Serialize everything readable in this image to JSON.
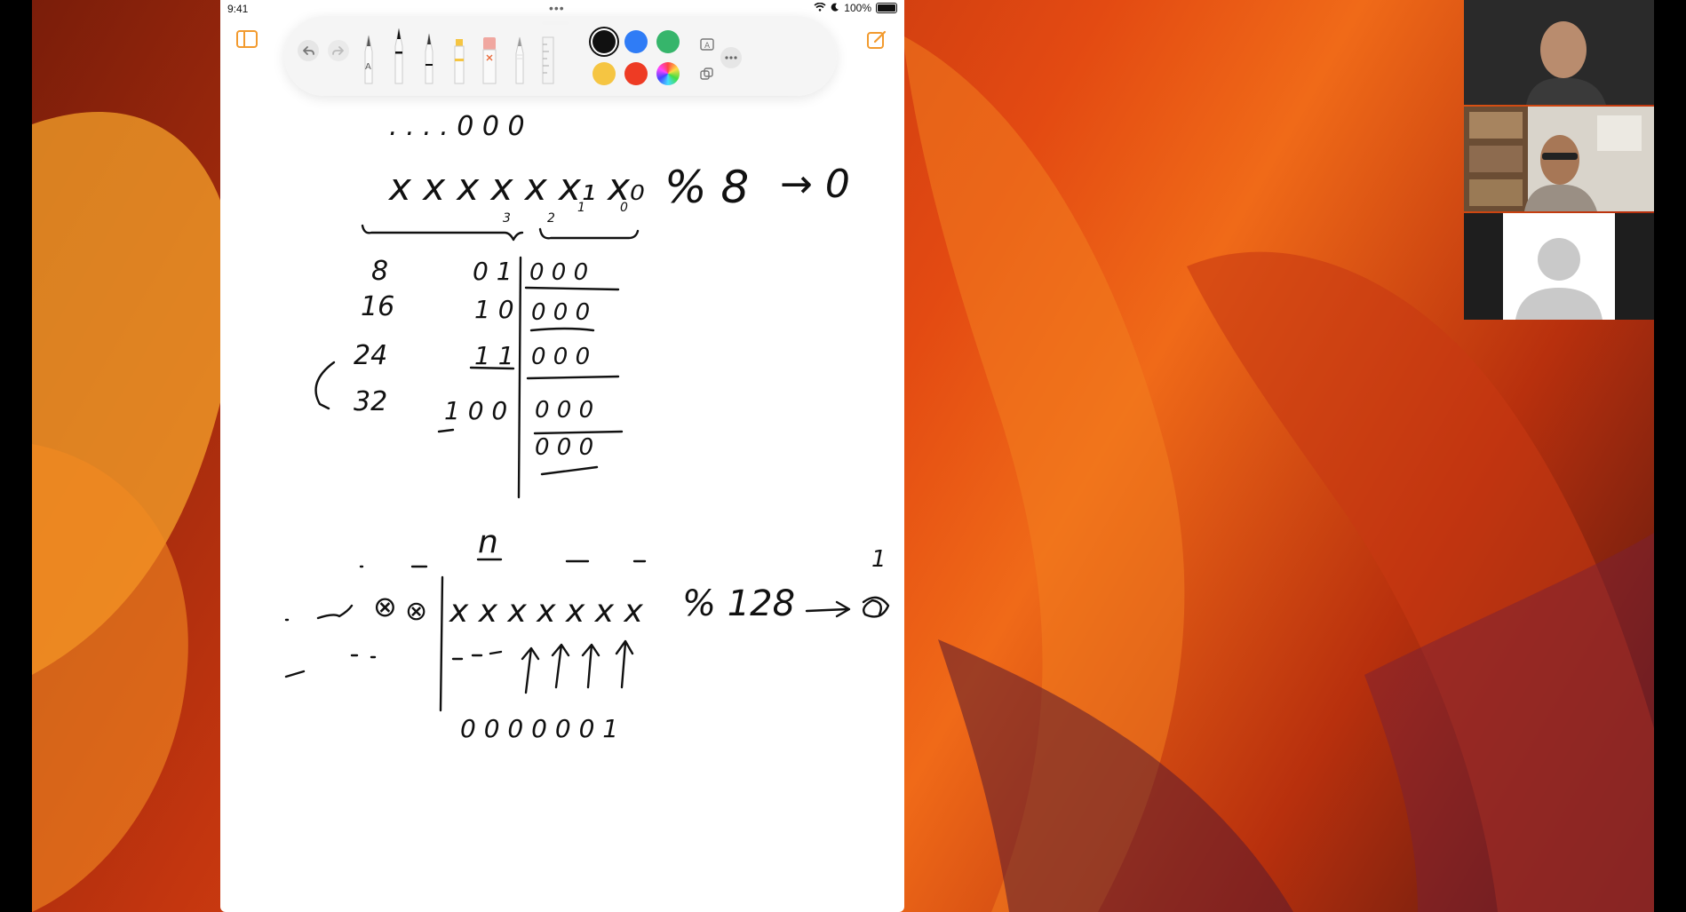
{
  "status_bar": {
    "time": "9:41",
    "battery": "100%",
    "multitask_dots": "•••"
  },
  "toolbar": {
    "undo_icon": "undo-icon",
    "redo_icon": "redo-icon",
    "tools": [
      "pen-a-tool",
      "pen-tool",
      "monoline-tool",
      "highlighter-tool",
      "eraser-tool",
      "pencil-tool",
      "ruler-tool"
    ],
    "colors": {
      "black": "#111111",
      "blue": "#2f7cf6",
      "green": "#36b56b",
      "yellow": "#f5c542",
      "red": "#ee3b24"
    },
    "more_icon": "ellipsis-icon"
  },
  "colors": {
    "accent": "#f29a2e",
    "wallpaper_main": "#e34a12"
  },
  "canvas": {
    "note_top": ". . . . 0 0 0",
    "bits_row": "x x x x x x₁ x₀",
    "mod8": "% 8",
    "arrow_result": "→ 0",
    "sub_3": "3",
    "sub_2": "2",
    "sub_1": "1",
    "sub_0": "0",
    "table_left": [
      "8",
      "16",
      "24",
      "32"
    ],
    "table_mid": [
      "0 1",
      "1 0",
      "1 1",
      "1 0 0"
    ],
    "table_right": [
      "0 0 0",
      "0 0 0",
      "0 0 0",
      "0 0 0",
      "0 0 0"
    ],
    "n_label": "n",
    "bits_row_2": "x x x x x x x",
    "mod128": "% 128",
    "one_label": "1",
    "bottom_bits": "0 0 0 0 0 0 1",
    "circled_1": "⊗",
    "circled_2": "⊗"
  }
}
